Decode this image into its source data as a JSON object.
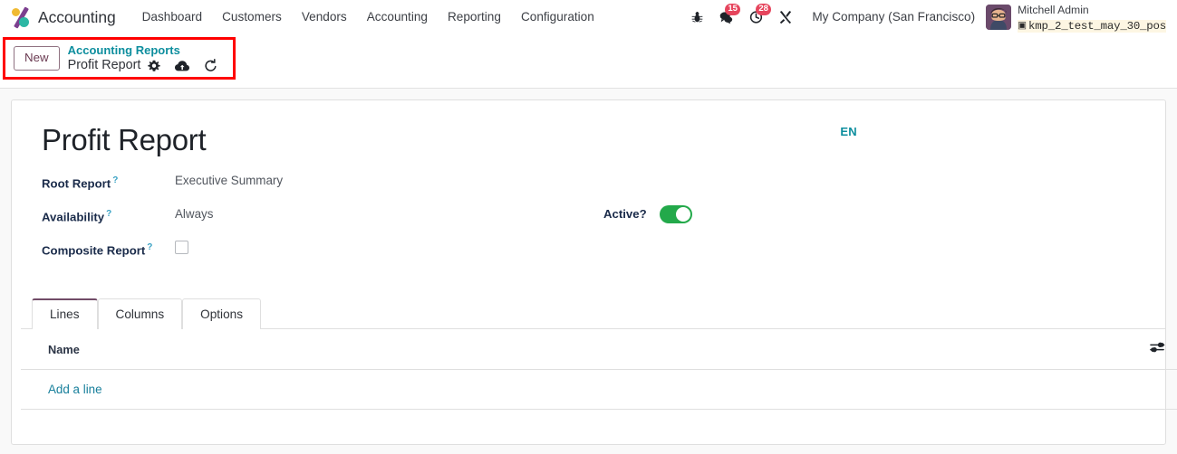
{
  "navbar": {
    "brand": "Accounting",
    "logo_icon": "odoo-logo-icon",
    "menu_items": [
      {
        "label": "Dashboard"
      },
      {
        "label": "Customers"
      },
      {
        "label": "Vendors"
      },
      {
        "label": "Accounting"
      },
      {
        "label": "Reporting"
      },
      {
        "label": "Configuration"
      }
    ],
    "icons": [
      {
        "name": "bug-icon",
        "glyph": "🐞",
        "badge": ""
      },
      {
        "name": "messages-icon",
        "glyph": "",
        "badge": "15"
      },
      {
        "name": "activities-clock-icon",
        "glyph": "",
        "badge": "28"
      },
      {
        "name": "tools-wrench-icon",
        "glyph": "",
        "badge": ""
      }
    ],
    "messages_badge": "15",
    "activities_badge": "28",
    "company": "My Company (San Francisco)",
    "user_name": "Mitchell Admin",
    "database_name": "kmp_2_test_may_30_pos",
    "database_icon": "database-icon"
  },
  "breadcrumb": {
    "new_button": "New",
    "parent": "Accounting Reports",
    "current": "Profit Report",
    "actions": [
      {
        "name": "gear-icon",
        "title": "Settings"
      },
      {
        "name": "cloud-upload-save-icon",
        "title": "Save manually"
      },
      {
        "name": "discard-undo-icon",
        "title": "Discard"
      }
    ],
    "highlight_color": "#ff0000"
  },
  "form": {
    "title": "Profit Report",
    "language_badge": "EN",
    "fields": [
      {
        "label": "Root Report",
        "help": "?",
        "value": "Executive Summary"
      },
      {
        "label": "Availability",
        "help": "?",
        "value": "Always"
      },
      {
        "label": "Composite Report",
        "help": "?",
        "value": ""
      }
    ],
    "active": {
      "label": "Active",
      "help": "?",
      "checked": true,
      "color": "#23a94a"
    },
    "composite_checked": false
  },
  "notebook": {
    "tabs": [
      {
        "label": "Lines",
        "active": true
      },
      {
        "label": "Columns",
        "active": false
      },
      {
        "label": "Options",
        "active": false
      }
    ],
    "table": {
      "columns": [
        "Name"
      ],
      "rows": [],
      "add_line_label": "Add a line",
      "optional_columns_icon": "optional-columns-sliders-icon"
    }
  },
  "colors": {
    "accent_teal": "#0d8e9e",
    "primary_purple": "#714b67",
    "success_green": "#23a94a",
    "badge_red": "#e6455d",
    "highlight_red": "#ff0000"
  }
}
